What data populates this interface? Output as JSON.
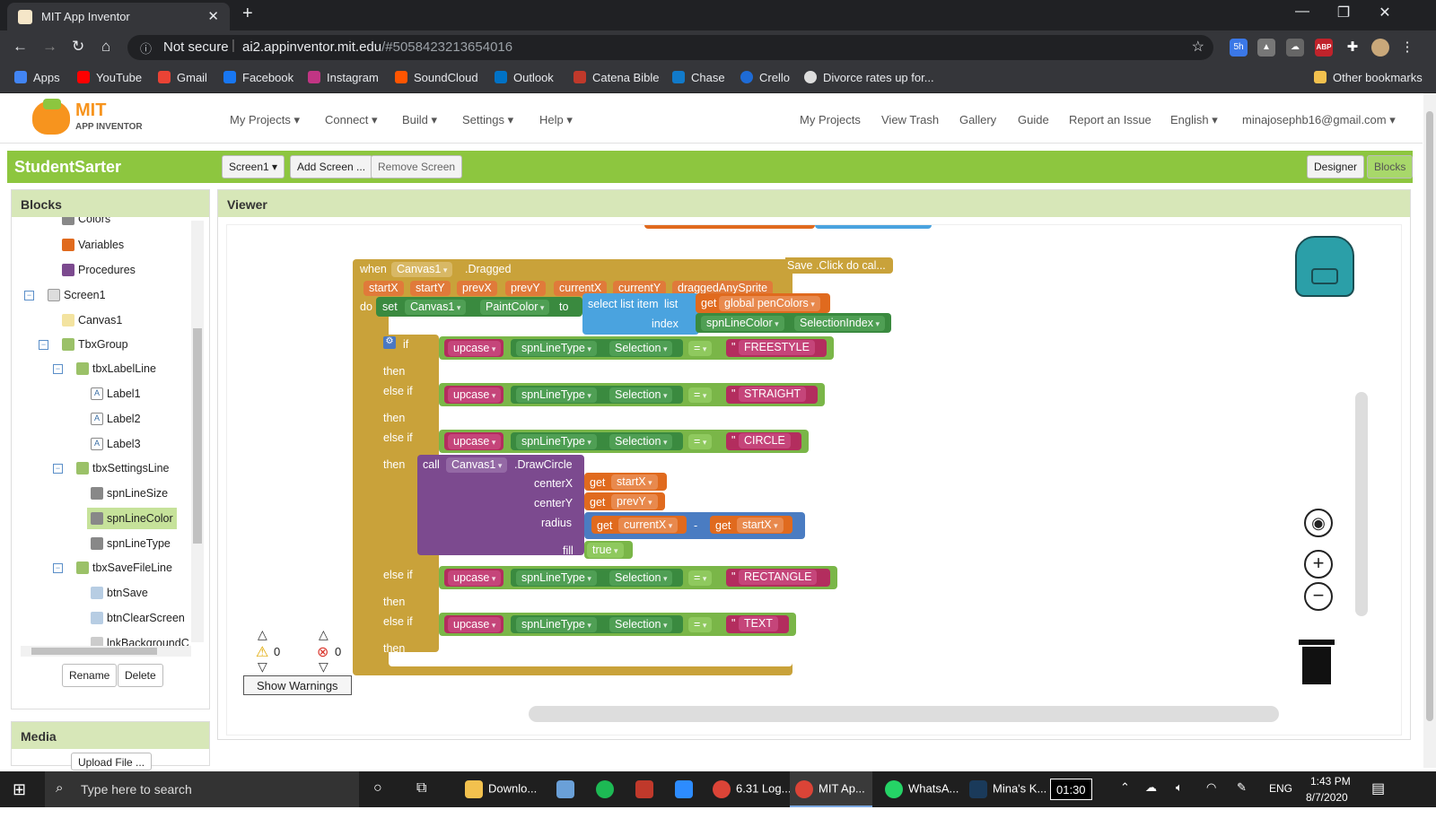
{
  "browser": {
    "tab_title": "MIT App Inventor",
    "address_secure_label": "Not secure",
    "address_host": "ai2.appinventor.mit.edu",
    "address_path": "/#5058423213654016",
    "bookmarks": [
      "Apps",
      "YouTube",
      "Gmail",
      "Facebook",
      "Instagram",
      "SoundCloud",
      "Outlook",
      "Catena Bible",
      "Chase",
      "Crello",
      "Divorce rates up for..."
    ],
    "other_bookmarks": "Other bookmarks",
    "ext_badge": "5h",
    "abp": "ABP"
  },
  "app": {
    "logo_mit": "MIT",
    "logo_sub": "APP INVENTOR",
    "menu_left": [
      "My Projects",
      "Connect",
      "Build",
      "Settings",
      "Help"
    ],
    "menu_right": [
      "My Projects",
      "View Trash",
      "Gallery",
      "Guide",
      "Report an Issue",
      "English",
      "minajosephb16@gmail.com"
    ],
    "project_name": "StudentSarter",
    "screen_select": "Screen1",
    "add_screen": "Add Screen ...",
    "remove_screen": "Remove Screen",
    "designer": "Designer",
    "blocks_btn": "Blocks"
  },
  "blocks_panel": {
    "title": "Blocks",
    "items": [
      "Colors",
      "Variables",
      "Procedures",
      "Screen1",
      "Canvas1",
      "TbxGroup",
      "tbxLabelLine",
      "Label1",
      "Label2",
      "Label3",
      "tbxSettingsLine",
      "spnLineSize",
      "spnLineColor",
      "spnLineType",
      "tbxSaveFileLine",
      "btnSave",
      "btnClearScreen",
      "lnkBackgroundC"
    ],
    "rename": "Rename",
    "delete": "Delete"
  },
  "media": {
    "title": "Media",
    "upload": "Upload File ..."
  },
  "viewer": {
    "title": "Viewer",
    "event": {
      "when": "when",
      "component": "Canvas1",
      "event": ".Dragged",
      "params": [
        "startX",
        "startY",
        "prevX",
        "prevY",
        "currentX",
        "currentY",
        "draggedAnySprite"
      ]
    },
    "comment": "Save .Click do cal...",
    "do": "do",
    "set": "set",
    "set_comp": "Canvas1",
    "set_prop": "PaintColor",
    "to": "to",
    "select_list": "select list item",
    "list": "list",
    "get": "get",
    "global_var": "global penColors",
    "index": "index",
    "index_comp": "spnLineColor",
    "index_prop": "SelectionIndex",
    "if": "if",
    "else_if": "else if",
    "then": "then",
    "upcase": "upcase",
    "spinner": "spnLineType",
    "selection": "Selection",
    "eq": "=",
    "strings": [
      "FREESTYLE",
      "STRAIGHT",
      "CIRCLE",
      "RECTANGLE",
      "TEXT"
    ],
    "call": "call",
    "call_comp": "Canvas1",
    "call_method": ".DrawCircle",
    "centerX": "centerX",
    "centerY": "centerY",
    "radius": "radius",
    "fill": "fill",
    "startX": "startX",
    "prevY": "prevY",
    "currentX": "currentX",
    "minus": "-",
    "true": "true",
    "warnings_count": "0",
    "errors_count": "0",
    "show_warnings": "Show Warnings"
  },
  "taskbar": {
    "search": "Type here to search",
    "apps": [
      "Downlo...",
      "6.31 Log...",
      "MIT Ap...",
      "WhatsA...",
      "Mina's K..."
    ],
    "timer": "01:30",
    "lang": "ENG",
    "time": "1:43 PM",
    "date": "8/7/2020"
  },
  "colors": {
    "green": "#8dc63f",
    "event": "#c9a23a",
    "component": "#3a8a3f",
    "list": "#4aa3df",
    "text": "#b32d5e",
    "var": "#e06a1e",
    "proc": "#7c4a8f"
  }
}
